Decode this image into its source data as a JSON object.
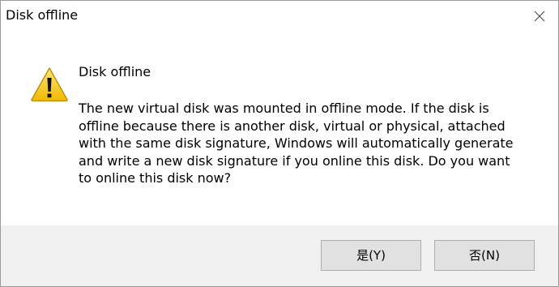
{
  "window": {
    "title": "Disk offline",
    "close_icon": "close-icon"
  },
  "content": {
    "icon": "warning-icon",
    "heading": "Disk offline",
    "message_lines": [
      "The new virtual disk was mounted in offline mode. If the disk is",
      "offline because there is another disk, virtual or physical, attached",
      "with the same disk signature, Windows will automatically generate",
      "and write a new disk signature if you online this disk. Do you want",
      "to online this disk now?"
    ]
  },
  "buttons": {
    "yes_label": "是(Y)",
    "no_label": "否(N)"
  },
  "colors": {
    "footer_bg": "#f0f0f0",
    "button_bg": "#e1e1e1",
    "button_border": "#adadad",
    "warning_yellow": "#f4c81e"
  }
}
